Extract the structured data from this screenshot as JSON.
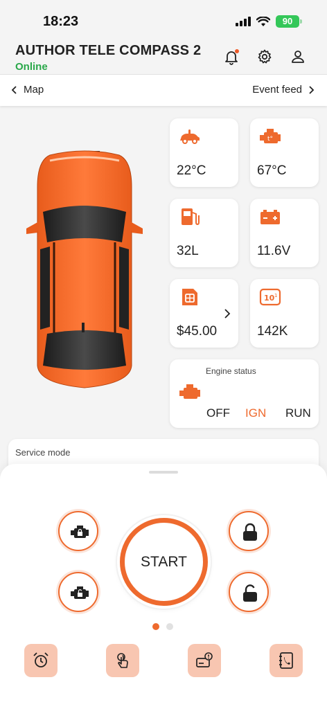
{
  "status_bar": {
    "time": "18:23",
    "battery": "90"
  },
  "header": {
    "title": "AUTHOR TELE COMPASS 2",
    "status": "Online"
  },
  "nav": {
    "left_label": "Map",
    "right_label": "Event feed"
  },
  "tiles": [
    {
      "icon": "car-temperature-icon",
      "value": "22°C"
    },
    {
      "icon": "engine-temperature-icon",
      "value": "67°C"
    },
    {
      "icon": "fuel-icon",
      "value": "32L"
    },
    {
      "icon": "battery-icon",
      "value": "11.6V"
    },
    {
      "icon": "sim-card-icon",
      "value": "$45.00"
    },
    {
      "icon": "odometer-icon",
      "value": "142K"
    }
  ],
  "engine": {
    "title": "Engine status",
    "states": [
      "OFF",
      "IGN",
      "RUN"
    ],
    "active_state": "IGN"
  },
  "service": {
    "label": "Service mode"
  },
  "controls": {
    "start_label": "START"
  },
  "pager": {
    "pages": 2,
    "current": 1
  },
  "bottom_actions": [
    "alarm-clock-icon",
    "touch-icon",
    "card-alert-icon",
    "phonebook-icon"
  ],
  "colors": {
    "accent": "#ee6a2e",
    "online": "#2aa84a",
    "battery": "#34c759",
    "action_bg": "#f8c6b1"
  }
}
